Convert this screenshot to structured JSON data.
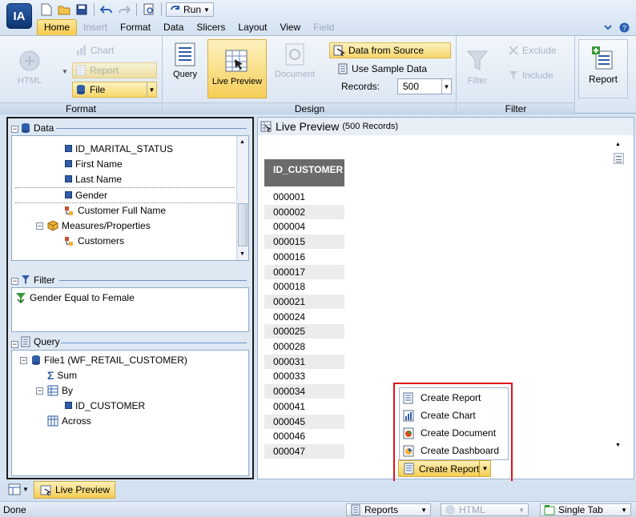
{
  "app": {
    "logo_text": "IA"
  },
  "qat": {
    "run_label": "Run"
  },
  "menu": [
    "Home",
    "Insert",
    "Format",
    "Data",
    "Slicers",
    "Layout",
    "View",
    "Field"
  ],
  "ribbon": {
    "format": {
      "group_label": "Format",
      "html_label": "HTML",
      "chart_label": "Chart",
      "report_label": "Report",
      "file_label": "File"
    },
    "design": {
      "group_label": "Design",
      "query_label": "Query",
      "live_preview_label": "Live Preview",
      "document_label": "Document",
      "data_from_source_label": "Data from Source",
      "use_sample_data_label": "Use Sample Data",
      "records_label": "Records:",
      "records_value": "500"
    },
    "filter": {
      "group_label": "Filter",
      "filter_label": "Filter",
      "exclude_label": "Exclude",
      "include_label": "Include"
    },
    "report": {
      "report_label": "Report"
    }
  },
  "left": {
    "data_title": "Data",
    "data_items": [
      "ID_MARITAL_STATUS",
      "First Name",
      "Last Name",
      "Gender",
      "Customer Full Name",
      "Measures/Properties",
      "Customers"
    ],
    "filter_title": "Filter",
    "filter_item": "Gender Equal to Female",
    "query_title": "Query",
    "query_items": [
      "File1 (WF_RETAIL_CUSTOMER)",
      "Sum",
      "By",
      "ID_CUSTOMER",
      "Across"
    ]
  },
  "preview": {
    "title": "Live Preview",
    "records": "(500 Records)",
    "column": "ID_CUSTOMER",
    "rows": [
      "000001",
      "000002",
      "000004",
      "000015",
      "000016",
      "000017",
      "000018",
      "000021",
      "000024",
      "000025",
      "000028",
      "000031",
      "000033",
      "000034",
      "000041",
      "000045",
      "000046",
      "000047"
    ]
  },
  "popup": {
    "items": [
      "Create Report",
      "Create Chart",
      "Create Document",
      "Create Dashboard"
    ],
    "button_label": "Create Report"
  },
  "bottom_tab": {
    "label": "Live Preview"
  },
  "status": {
    "text": "Done",
    "reports_label": "Reports",
    "html_label": "HTML",
    "single_tab_label": "Single Tab"
  },
  "colors": {
    "accent_gold": "#f5cd55",
    "highlight_red": "#e0121a",
    "header_gray": "#6b6b6b"
  }
}
